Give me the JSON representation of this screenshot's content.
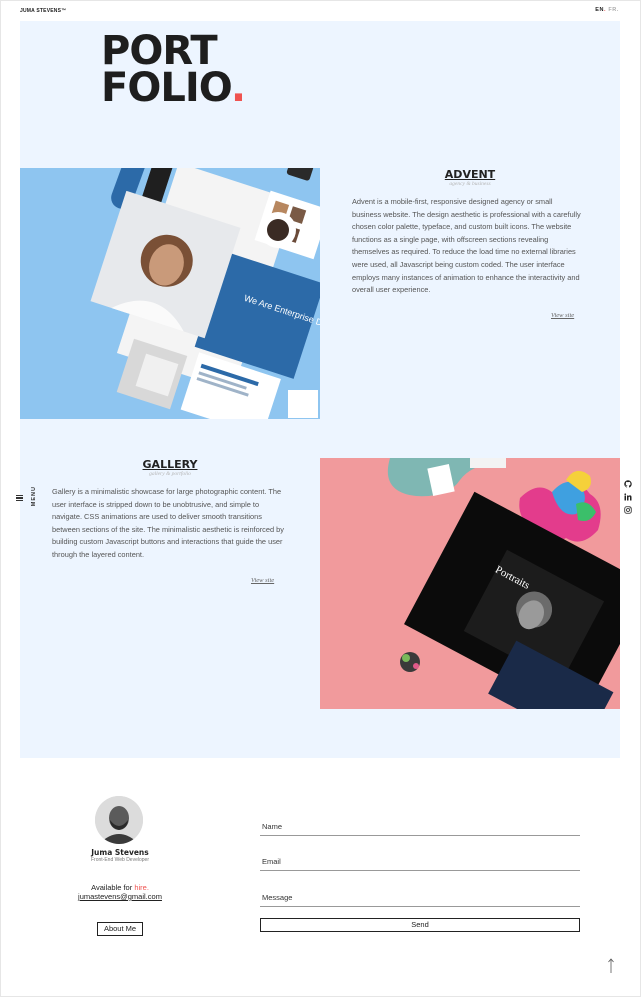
{
  "header": {
    "brand": "JUMA STEVENS™",
    "lang_en": "EN",
    "lang_sep": ".",
    "lang_fr": "FR."
  },
  "hero": {
    "logo_line1": "PORT",
    "logo_line2": "FOLIO",
    "logo_dot": "."
  },
  "menu": {
    "label": "MENU"
  },
  "projects": [
    {
      "title": "ADVENT",
      "subtitle": "agency & business",
      "description": "Advent is a mobile-first, responsive designed agency or small business website. The design aesthetic is professional with a carefully chosen color palette, typeface, and custom built icons. The website functions as a single page, with offscreen sections revealing themselves as required. To reduce the load time no external libraries were used, all Javascript being custom coded. The user interface employs many instances of animation to enhance the interactivity and overall user experience.",
      "link": "View site",
      "mockup_text": "We Are Enterprise Digital Agency"
    },
    {
      "title": "GALLERY",
      "subtitle": "gallery & portfolio",
      "description": "Gallery is a minimalistic showcase for large photographic content. The user interface is stripped down to be unobtrusive, and simple to navigate. CSS animations are used to deliver smooth transitions between sections of the site. The minimalistic aesthetic is reinforced by building custom Javascript buttons and interactions that guide the user through the layered content.",
      "link": "View site",
      "mockup_text": "Portraits"
    }
  ],
  "socials": [
    "github-icon",
    "linkedin-icon",
    "instagram-icon"
  ],
  "profile": {
    "name": "Juma Stevens",
    "role": "Front-End Web Developer",
    "available_prefix": "Available for ",
    "available_hire": "hire.",
    "email": "jumastevens@gmail.com",
    "about_button": "About Me"
  },
  "contact_form": {
    "name_label": "Name",
    "email_label": "Email",
    "message_label": "Message",
    "send_button": "Send"
  },
  "colors": {
    "panel": "#edf5ff",
    "accent": "#ef5350",
    "advent_bg": "#8ec5f0",
    "gallery_bg": "#f19a9c"
  }
}
